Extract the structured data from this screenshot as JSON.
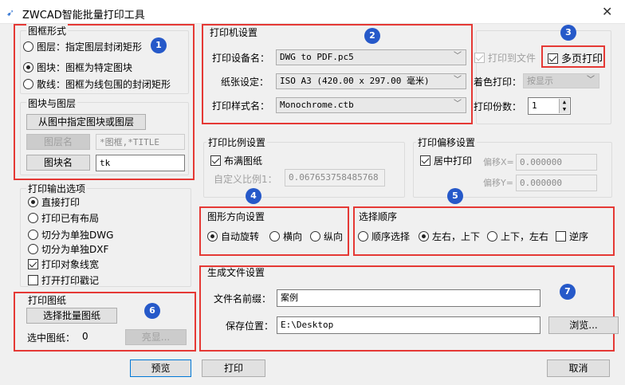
{
  "window": {
    "title": "ZWCAD智能批量打印工具",
    "close": "✕"
  },
  "badges": [
    "1",
    "2",
    "3",
    "4",
    "5",
    "6",
    "7"
  ],
  "frame_form": {
    "title": "图框形式",
    "options": [
      "图层：指定图层封闭矩形",
      "图块：图框为特定图块",
      "散线：图框为线包围的封闭矩形"
    ],
    "selected": 1
  },
  "block_layer": {
    "title": "图块与图层",
    "pick_button": "从图中指定图块或图层",
    "layer_button": "图层名",
    "layer_value": "*图框,*TITLE",
    "block_button": "图块名",
    "block_value": "tk"
  },
  "output": {
    "title": "打印输出选项",
    "radios": [
      "直接打印",
      "打印已有布局",
      "切分为单独DWG",
      "切分为单独DXF"
    ],
    "selected": 0,
    "checks": [
      {
        "label": "打印对象线宽",
        "checked": true
      },
      {
        "label": "打开打印戳记",
        "checked": false
      }
    ]
  },
  "drawings": {
    "title": "打印图纸",
    "select_button": "选择批量图纸",
    "selected_label": "选中图纸：",
    "selected_count": "0",
    "highlight_button": "亮显..."
  },
  "printer": {
    "title": "打印机设置",
    "device_label": "打印设备名：",
    "device": "DWG to PDF.pc5",
    "paper_label": "纸张设定：",
    "paper": "ISO A3 (420.00 x 297.00 毫米)",
    "style_label": "打印样式名：",
    "style": "Monochrome.ctb"
  },
  "extra": {
    "print_to_file": "打印到文件",
    "multi_page": "多页打印",
    "shade_label": "着色打印：",
    "shade": "按显示",
    "copies_label": "打印份数：",
    "copies": "1"
  },
  "scale": {
    "title": "打印比例设置",
    "fit": "布满图纸",
    "custom_label": "自定义比例1：",
    "custom_value": "0.067653758485768"
  },
  "offset": {
    "title": "打印偏移设置",
    "center": "居中打印",
    "x_label": "偏移X=",
    "x_value": "0.000000",
    "y_label": "偏移Y=",
    "y_value": "0.000000"
  },
  "orientation": {
    "title": "图形方向设置",
    "options": [
      "自动旋转",
      "横向",
      "纵向"
    ],
    "selected": 0
  },
  "order": {
    "title": "选择顺序",
    "options": [
      "顺序选择",
      "左右，上下",
      "上下，左右"
    ],
    "selected": 1,
    "reverse": "逆序"
  },
  "file": {
    "title": "生成文件设置",
    "prefix_label": "文件名前缀：",
    "prefix": "案例",
    "path_label": "保存位置：",
    "path": "E:\\Desktop",
    "browse": "浏览..."
  },
  "footer": {
    "preview": "预览",
    "print": "打印",
    "cancel": "取消"
  }
}
